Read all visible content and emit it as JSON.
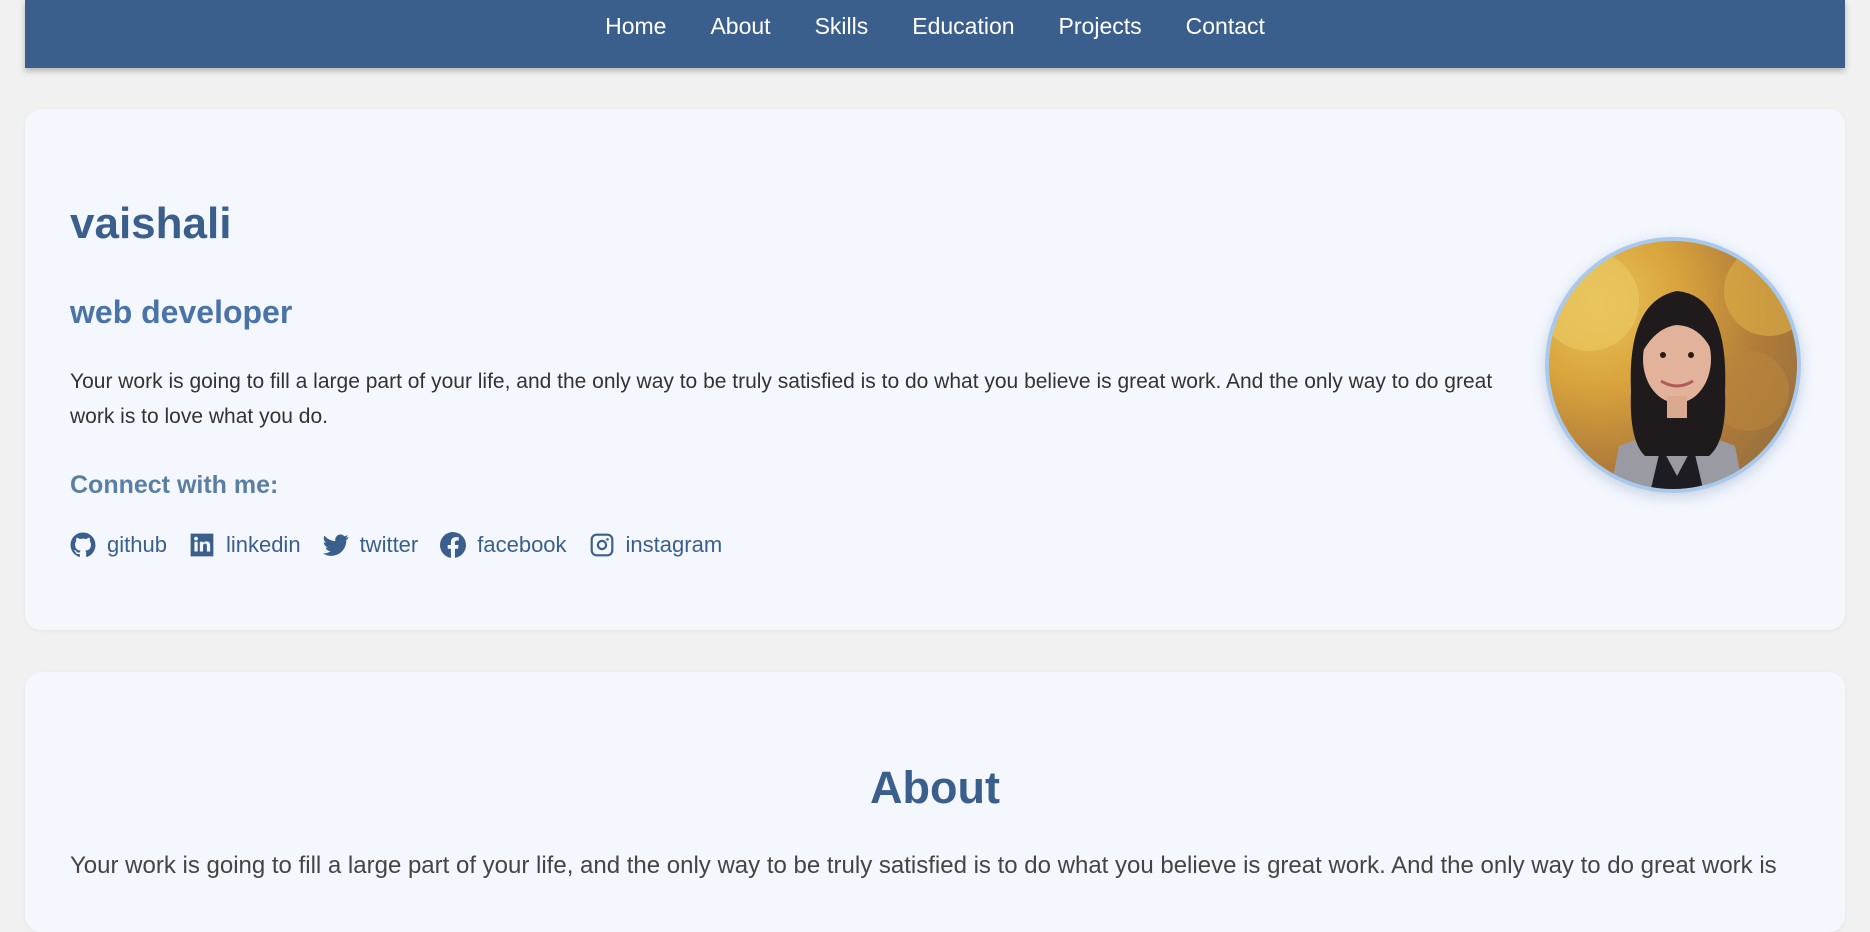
{
  "nav": {
    "items": [
      {
        "label": "Home"
      },
      {
        "label": "About"
      },
      {
        "label": "Skills"
      },
      {
        "label": "Education"
      },
      {
        "label": "Projects"
      },
      {
        "label": "Contact"
      }
    ]
  },
  "hero": {
    "name": "vaishali",
    "role": "web developer",
    "description": "Your work is going to fill a large part of your life, and the only way to be truly satisfied is to do what you believe is great work. And the only way to do great work is to love what you do.",
    "connect_title": "Connect with me:",
    "socials": [
      {
        "label": "github",
        "icon": "github-icon"
      },
      {
        "label": "linkedin",
        "icon": "linkedin-icon"
      },
      {
        "label": "twitter",
        "icon": "twitter-icon"
      },
      {
        "label": "facebook",
        "icon": "facebook-icon"
      },
      {
        "label": "instagram",
        "icon": "instagram-icon"
      }
    ]
  },
  "about": {
    "title": "About",
    "text": "Your work is going to fill a large part of your life, and the only way to be truly satisfied is to do what you believe is great work. And the only way to do great work is"
  },
  "colors": {
    "nav_bg": "#3b5f8c",
    "card_bg": "#f4f7fe",
    "heading": "#3b5f8c",
    "subheading": "#4a74a8",
    "page_bg": "#f1f1f1",
    "avatar_ring": "#a9c9ec"
  }
}
